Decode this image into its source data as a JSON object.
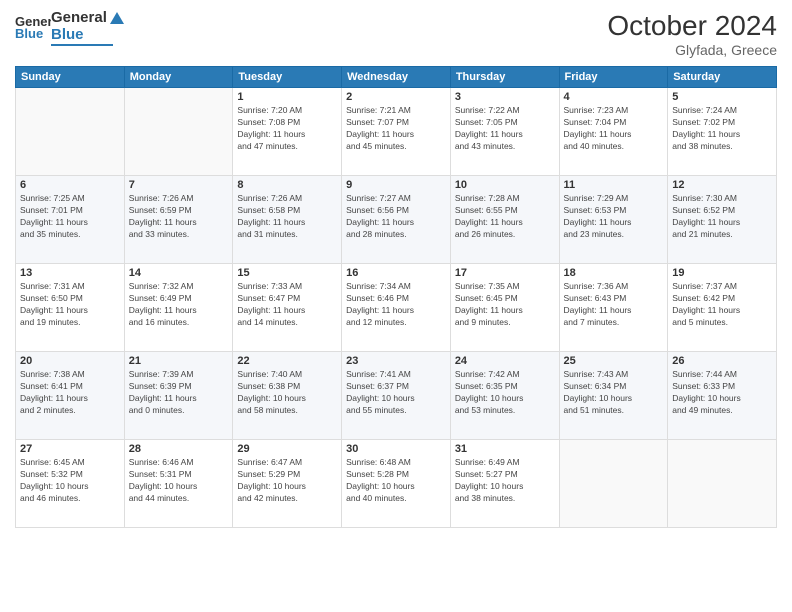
{
  "header": {
    "logo_general": "General",
    "logo_blue": "Blue",
    "month_title": "October 2024",
    "location": "Glyfada, Greece"
  },
  "weekdays": [
    "Sunday",
    "Monday",
    "Tuesday",
    "Wednesday",
    "Thursday",
    "Friday",
    "Saturday"
  ],
  "weeks": [
    [
      {
        "day": "",
        "info": ""
      },
      {
        "day": "",
        "info": ""
      },
      {
        "day": "1",
        "info": "Sunrise: 7:20 AM\nSunset: 7:08 PM\nDaylight: 11 hours\nand 47 minutes."
      },
      {
        "day": "2",
        "info": "Sunrise: 7:21 AM\nSunset: 7:07 PM\nDaylight: 11 hours\nand 45 minutes."
      },
      {
        "day": "3",
        "info": "Sunrise: 7:22 AM\nSunset: 7:05 PM\nDaylight: 11 hours\nand 43 minutes."
      },
      {
        "day": "4",
        "info": "Sunrise: 7:23 AM\nSunset: 7:04 PM\nDaylight: 11 hours\nand 40 minutes."
      },
      {
        "day": "5",
        "info": "Sunrise: 7:24 AM\nSunset: 7:02 PM\nDaylight: 11 hours\nand 38 minutes."
      }
    ],
    [
      {
        "day": "6",
        "info": "Sunrise: 7:25 AM\nSunset: 7:01 PM\nDaylight: 11 hours\nand 35 minutes."
      },
      {
        "day": "7",
        "info": "Sunrise: 7:26 AM\nSunset: 6:59 PM\nDaylight: 11 hours\nand 33 minutes."
      },
      {
        "day": "8",
        "info": "Sunrise: 7:26 AM\nSunset: 6:58 PM\nDaylight: 11 hours\nand 31 minutes."
      },
      {
        "day": "9",
        "info": "Sunrise: 7:27 AM\nSunset: 6:56 PM\nDaylight: 11 hours\nand 28 minutes."
      },
      {
        "day": "10",
        "info": "Sunrise: 7:28 AM\nSunset: 6:55 PM\nDaylight: 11 hours\nand 26 minutes."
      },
      {
        "day": "11",
        "info": "Sunrise: 7:29 AM\nSunset: 6:53 PM\nDaylight: 11 hours\nand 23 minutes."
      },
      {
        "day": "12",
        "info": "Sunrise: 7:30 AM\nSunset: 6:52 PM\nDaylight: 11 hours\nand 21 minutes."
      }
    ],
    [
      {
        "day": "13",
        "info": "Sunrise: 7:31 AM\nSunset: 6:50 PM\nDaylight: 11 hours\nand 19 minutes."
      },
      {
        "day": "14",
        "info": "Sunrise: 7:32 AM\nSunset: 6:49 PM\nDaylight: 11 hours\nand 16 minutes."
      },
      {
        "day": "15",
        "info": "Sunrise: 7:33 AM\nSunset: 6:47 PM\nDaylight: 11 hours\nand 14 minutes."
      },
      {
        "day": "16",
        "info": "Sunrise: 7:34 AM\nSunset: 6:46 PM\nDaylight: 11 hours\nand 12 minutes."
      },
      {
        "day": "17",
        "info": "Sunrise: 7:35 AM\nSunset: 6:45 PM\nDaylight: 11 hours\nand 9 minutes."
      },
      {
        "day": "18",
        "info": "Sunrise: 7:36 AM\nSunset: 6:43 PM\nDaylight: 11 hours\nand 7 minutes."
      },
      {
        "day": "19",
        "info": "Sunrise: 7:37 AM\nSunset: 6:42 PM\nDaylight: 11 hours\nand 5 minutes."
      }
    ],
    [
      {
        "day": "20",
        "info": "Sunrise: 7:38 AM\nSunset: 6:41 PM\nDaylight: 11 hours\nand 2 minutes."
      },
      {
        "day": "21",
        "info": "Sunrise: 7:39 AM\nSunset: 6:39 PM\nDaylight: 11 hours\nand 0 minutes."
      },
      {
        "day": "22",
        "info": "Sunrise: 7:40 AM\nSunset: 6:38 PM\nDaylight: 10 hours\nand 58 minutes."
      },
      {
        "day": "23",
        "info": "Sunrise: 7:41 AM\nSunset: 6:37 PM\nDaylight: 10 hours\nand 55 minutes."
      },
      {
        "day": "24",
        "info": "Sunrise: 7:42 AM\nSunset: 6:35 PM\nDaylight: 10 hours\nand 53 minutes."
      },
      {
        "day": "25",
        "info": "Sunrise: 7:43 AM\nSunset: 6:34 PM\nDaylight: 10 hours\nand 51 minutes."
      },
      {
        "day": "26",
        "info": "Sunrise: 7:44 AM\nSunset: 6:33 PM\nDaylight: 10 hours\nand 49 minutes."
      }
    ],
    [
      {
        "day": "27",
        "info": "Sunrise: 6:45 AM\nSunset: 5:32 PM\nDaylight: 10 hours\nand 46 minutes."
      },
      {
        "day": "28",
        "info": "Sunrise: 6:46 AM\nSunset: 5:31 PM\nDaylight: 10 hours\nand 44 minutes."
      },
      {
        "day": "29",
        "info": "Sunrise: 6:47 AM\nSunset: 5:29 PM\nDaylight: 10 hours\nand 42 minutes."
      },
      {
        "day": "30",
        "info": "Sunrise: 6:48 AM\nSunset: 5:28 PM\nDaylight: 10 hours\nand 40 minutes."
      },
      {
        "day": "31",
        "info": "Sunrise: 6:49 AM\nSunset: 5:27 PM\nDaylight: 10 hours\nand 38 minutes."
      },
      {
        "day": "",
        "info": ""
      },
      {
        "day": "",
        "info": ""
      }
    ]
  ]
}
